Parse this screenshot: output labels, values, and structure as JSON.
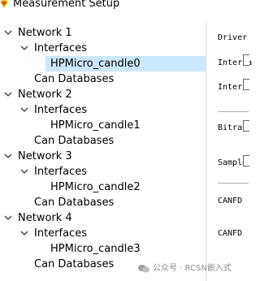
{
  "window": {
    "title": "Measurement Setup"
  },
  "tree": {
    "networks": [
      {
        "label": "Network 1",
        "interfaces_label": "Interfaces",
        "interface": "HPMicro_candle0",
        "can_databases_label": "Can Databases",
        "selected": true
      },
      {
        "label": "Network 2",
        "interfaces_label": "Interfaces",
        "interface": "HPMicro_candle1",
        "can_databases_label": "Can Databases",
        "selected": false
      },
      {
        "label": "Network 3",
        "interfaces_label": "Interfaces",
        "interface": "HPMicro_candle2",
        "can_databases_label": "Can Databases",
        "selected": false
      },
      {
        "label": "Network 4",
        "interfaces_label": "Interfaces",
        "interface": "HPMicro_candle3",
        "can_databases_label": "Can Databases",
        "selected": false
      }
    ]
  },
  "panel": {
    "labels": [
      "Driver",
      "Interfa",
      "Interf",
      "Bitrat",
      "Sample",
      "CANFD ",
      "CANFD "
    ]
  },
  "watermark": {
    "text": "公众号 · RCSN嵌入式"
  },
  "colors": {
    "selection": "#cce8ff",
    "chevron": "#3c3c3c",
    "separator": "#b0b0b0",
    "watermark": "#8a8a8a"
  }
}
